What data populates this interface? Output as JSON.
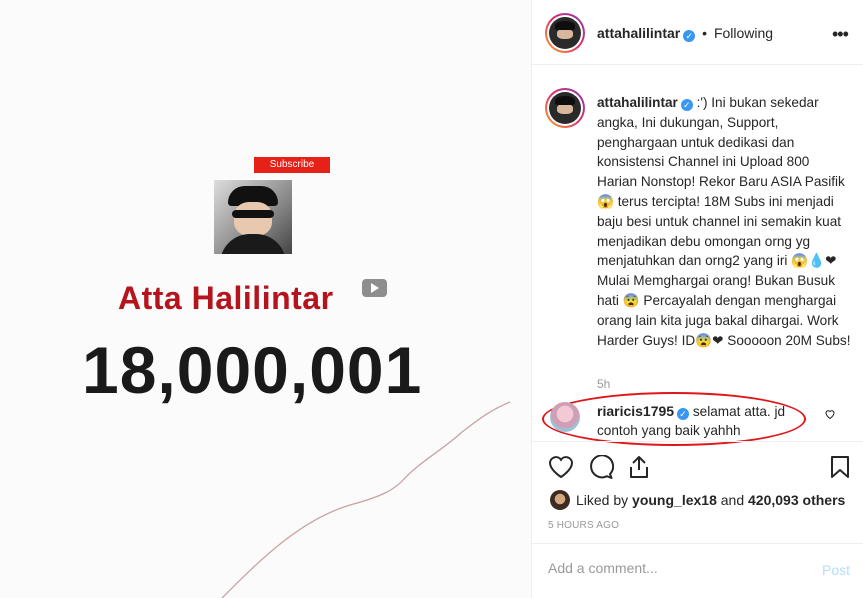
{
  "media": {
    "subscribe_label": "Subscribe",
    "channel_name": "Atta Halilintar",
    "subscriber_count": "18,000,001"
  },
  "header": {
    "username": "attahalilintar",
    "separator": "•",
    "follow_status": "Following",
    "more_icon": "more-horizontal-icon"
  },
  "caption": {
    "username": "attahalilintar",
    "text": ":') Ini bukan sekedar angka, Ini dukungan, Support, penghargaan untuk dedikasi dan konsistensi Channel ini Upload 800 Harian Nonstop! Rekor Baru ASIA Pasifik😱 terus tercipta! 18M Subs ini menjadi baju besi untuk channel ini semakin kuat menjadikan debu omongan orng yg menjatuhkan dan orng2 yang iri 😱💧❤ Mulai Memghargai orang! Bukan Busuk hati 😨 Percayalah dengan menghargai orang lain kita juga bakal dihargai. Work Harder Guys! ID😨❤ Sooooon 20M Subs!",
    "time_ago": "5h"
  },
  "comment": {
    "username": "riaricis1795",
    "text": "selamat atta. jd contoh yang baik yahhh"
  },
  "actions": {
    "like_icon": "heart-icon",
    "comment_icon": "comment-icon",
    "share_icon": "share-icon",
    "save_icon": "bookmark-icon"
  },
  "likes": {
    "prefix": "Liked by ",
    "user": "young_lex18",
    "middle": " and ",
    "count": "420,093 others"
  },
  "posted": "5 HOURS AGO",
  "add_comment": {
    "placeholder": "Add a comment...",
    "post_label": "Post"
  },
  "colors": {
    "accent_blue": "#3897f0",
    "highlight_red": "#e0161b",
    "channel_red": "#b5141d"
  }
}
